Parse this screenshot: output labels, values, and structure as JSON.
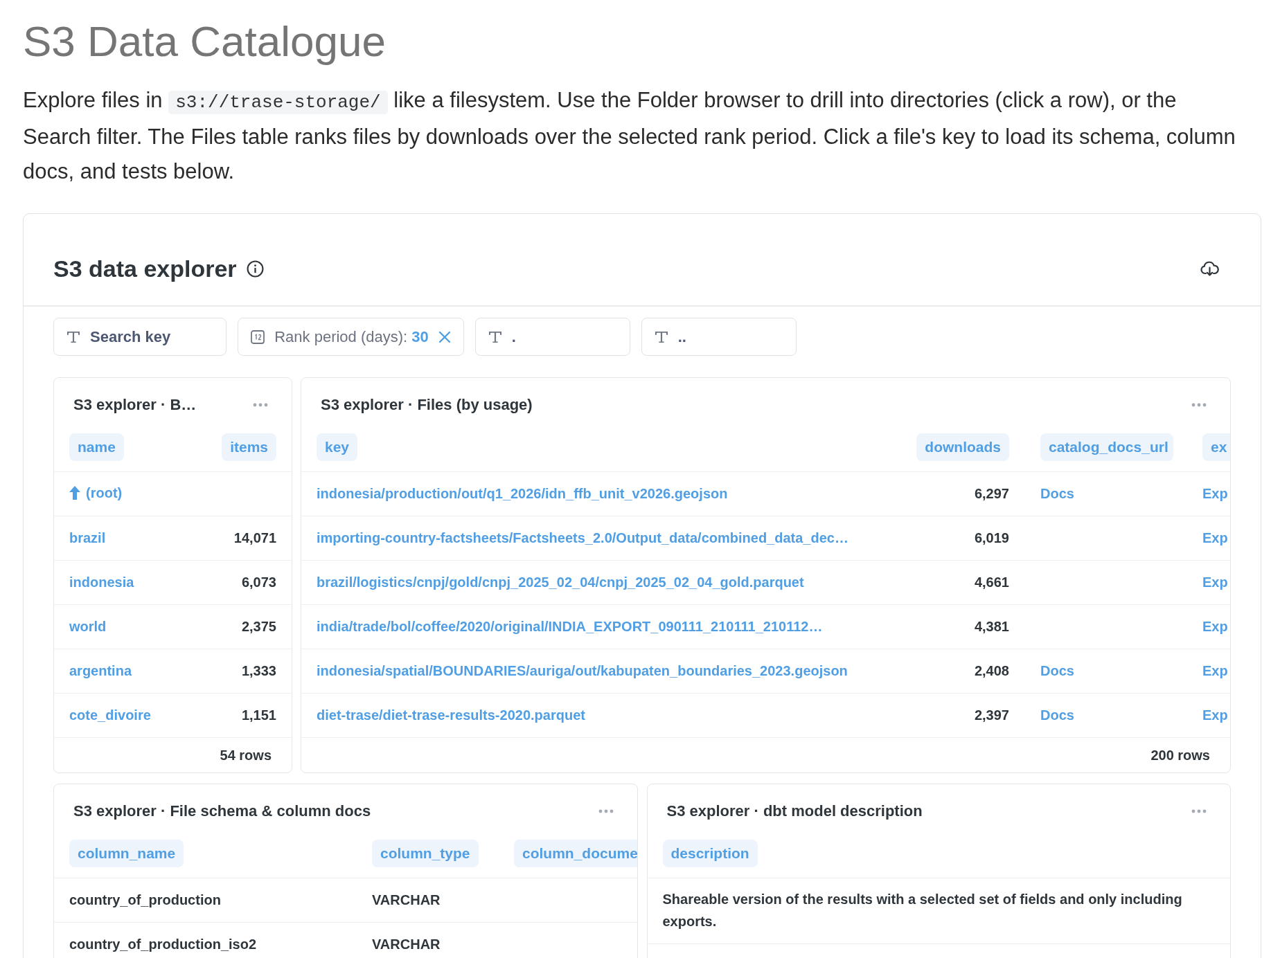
{
  "page": {
    "title": "S3 Data Catalogue",
    "intro": {
      "before": "Explore files in",
      "code": "s3://trase-storage/",
      "after": "like a filesystem. Use the Folder browser to drill into directories (click a row), or the Search filter. The Files table ranks files by downloads over the selected rank period. Click a file's key to load its schema, column docs, and tests below."
    }
  },
  "dashboard": {
    "title": "S3 data explorer",
    "filters": [
      {
        "kind": "text",
        "label": "Search key"
      },
      {
        "kind": "date",
        "label": "Rank period (days):",
        "value": "30"
      },
      {
        "kind": "text",
        "label": "."
      },
      {
        "kind": "text",
        "label": ".."
      }
    ]
  },
  "folder_browser": {
    "title": "S3 explorer · B…",
    "columns": [
      "name",
      "items"
    ],
    "rows": [
      {
        "kind": "parent",
        "name": "(root)"
      },
      {
        "kind": "folder",
        "name": "brazil",
        "items": "14,071"
      },
      {
        "kind": "folder",
        "name": "indonesia",
        "items": "6,073"
      },
      {
        "kind": "folder",
        "name": "world",
        "items": "2,375"
      },
      {
        "kind": "folder",
        "name": "argentina",
        "items": "1,333"
      },
      {
        "kind": "folder",
        "name": "cote_divoire",
        "items": "1,151"
      }
    ],
    "footer": "54 rows"
  },
  "files_table": {
    "title": "S3 explorer · Files (by usage)",
    "columns": [
      "key",
      "downloads",
      "catalog_docs_url",
      "ex"
    ],
    "rows": [
      {
        "key": "indonesia/production/out/q1_2026/idn_ffb_unit_v2026.geojson",
        "downloads": "6,297",
        "catalog_docs_url": "Docs",
        "column_4": "Exp"
      },
      {
        "key": "importing-country-factsheets/Factsheets_2.0/Output_data/combined_data_dec…",
        "downloads": "6,019",
        "column_4": "Exp"
      },
      {
        "key": "brazil/logistics/cnpj/gold/cnpj_2025_02_04/cnpj_2025_02_04_gold.parquet",
        "downloads": "4,661",
        "column_4": "Exp"
      },
      {
        "key": "india/trade/bol/coffee/2020/original/INDIA_EXPORT_090111_210111_210112…",
        "downloads": "4,381",
        "column_4": "Exp"
      },
      {
        "key": "indonesia/spatial/BOUNDARIES/auriga/out/kabupaten_boundaries_2023.geojson",
        "downloads": "2,408",
        "catalog_docs_url": "Docs",
        "column_4": "Exp"
      },
      {
        "key": "diet-trase/diet-trase-results-2020.parquet",
        "downloads": "2,397",
        "catalog_docs_url": "Docs",
        "column_4": "Exp"
      }
    ],
    "footer": "200 rows"
  },
  "schema_table": {
    "title": "S3 explorer · File schema & column docs",
    "columns": [
      "column_name",
      "column_type",
      "column_docume"
    ],
    "rows": [
      {
        "column_name": "country_of_production",
        "column_type": "VARCHAR"
      },
      {
        "column_name": "country_of_production_iso2",
        "column_type": "VARCHAR"
      }
    ]
  },
  "model_description": {
    "title": "S3 explorer · dbt model description",
    "columns": [
      "description"
    ],
    "rows": [
      {
        "description": "Shareable version of the results with a selected set of fields and only including exports."
      }
    ]
  }
}
